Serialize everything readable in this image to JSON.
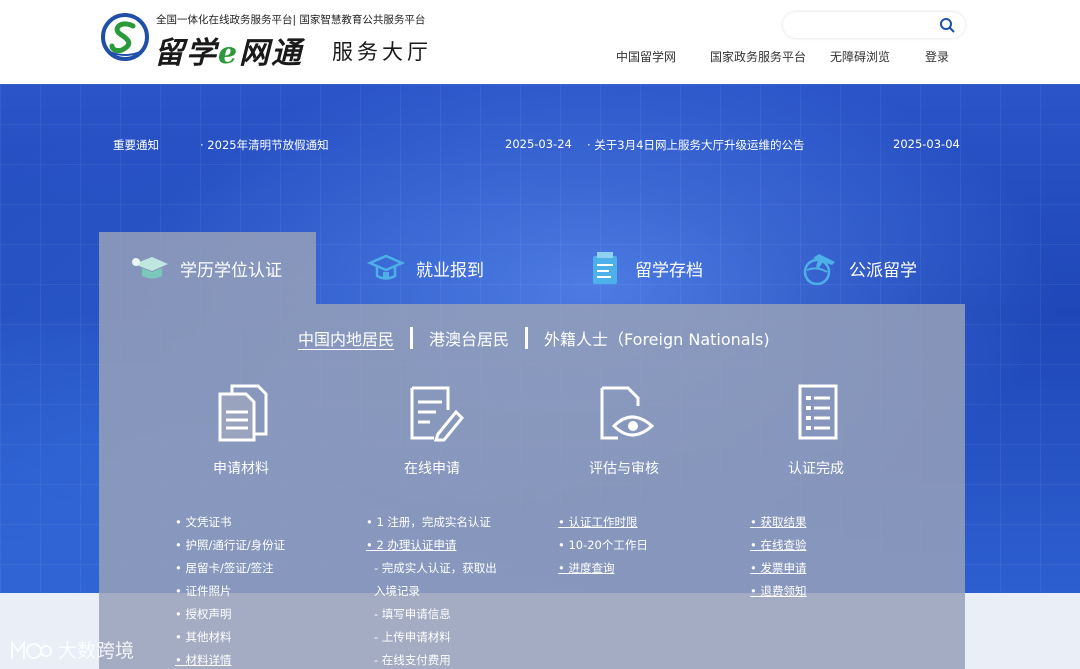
{
  "header": {
    "logo_subtitle": "全国一体化在线政务服务平台| 国家智慧教育公共服务平台",
    "logo_main_pre": "留学",
    "logo_main_e": "e",
    "logo_main_post": "网通",
    "logo_tail": "服务大厅",
    "search_placeholder": "",
    "nav": [
      "中国留学网",
      "国家政务服务平台",
      "无障碍浏览",
      "登录"
    ]
  },
  "notice": {
    "label": "重要通知",
    "items": [
      {
        "title": "· 2025年清明节放假通知",
        "date": "2025-03-24"
      },
      {
        "title": "· 关于3月4日网上服务大厅升级运维的公告",
        "date": "2025-03-04"
      }
    ]
  },
  "tabs": [
    {
      "label": "学历学位认证",
      "icon": "graduation-cap-icon",
      "active": true
    },
    {
      "label": "就业报到",
      "icon": "employment-icon",
      "active": false
    },
    {
      "label": "留学存档",
      "icon": "archive-icon",
      "active": false
    },
    {
      "label": "公派留学",
      "icon": "airplane-globe-icon",
      "active": false
    }
  ],
  "subtabs": [
    "中国内地居民",
    "港澳台居民",
    "外籍人士（Foreign Nationals)"
  ],
  "steps": [
    {
      "label": "申请材料",
      "icon": "documents-icon",
      "items": [
        "• 文凭证书",
        "• 护照/通行证/身份证",
        "• 居留卡/签证/签注",
        "• 证件照片",
        "• 授权声明",
        "• 其他材料",
        "• 材料详情"
      ]
    },
    {
      "label": "在线申请",
      "icon": "edit-form-icon",
      "items": [
        "• 1 注册，完成实名认证",
        "• 2 办理认证申请",
        "- 完成实人认证，获取出",
        "入境记录",
        "- 填写申请信息",
        "- 上传申请材料",
        "- 在线支付费用"
      ]
    },
    {
      "label": "评估与审核",
      "icon": "document-review-icon",
      "items": [
        "• 认证工作时限",
        "• 10-20个工作日",
        "• 进度查询"
      ]
    },
    {
      "label": "认证完成",
      "icon": "completed-list-icon",
      "items": [
        "• 获取结果",
        "• 在线查验",
        "• 发票申请",
        "• 退费领知"
      ]
    }
  ],
  "watermark": "大数跨境",
  "colors": {
    "hero_blue": "#2a54c8",
    "panel_gray": "#969fb9",
    "logo_green": "#2a9a3a",
    "logo_blue": "#1f4fa8"
  }
}
